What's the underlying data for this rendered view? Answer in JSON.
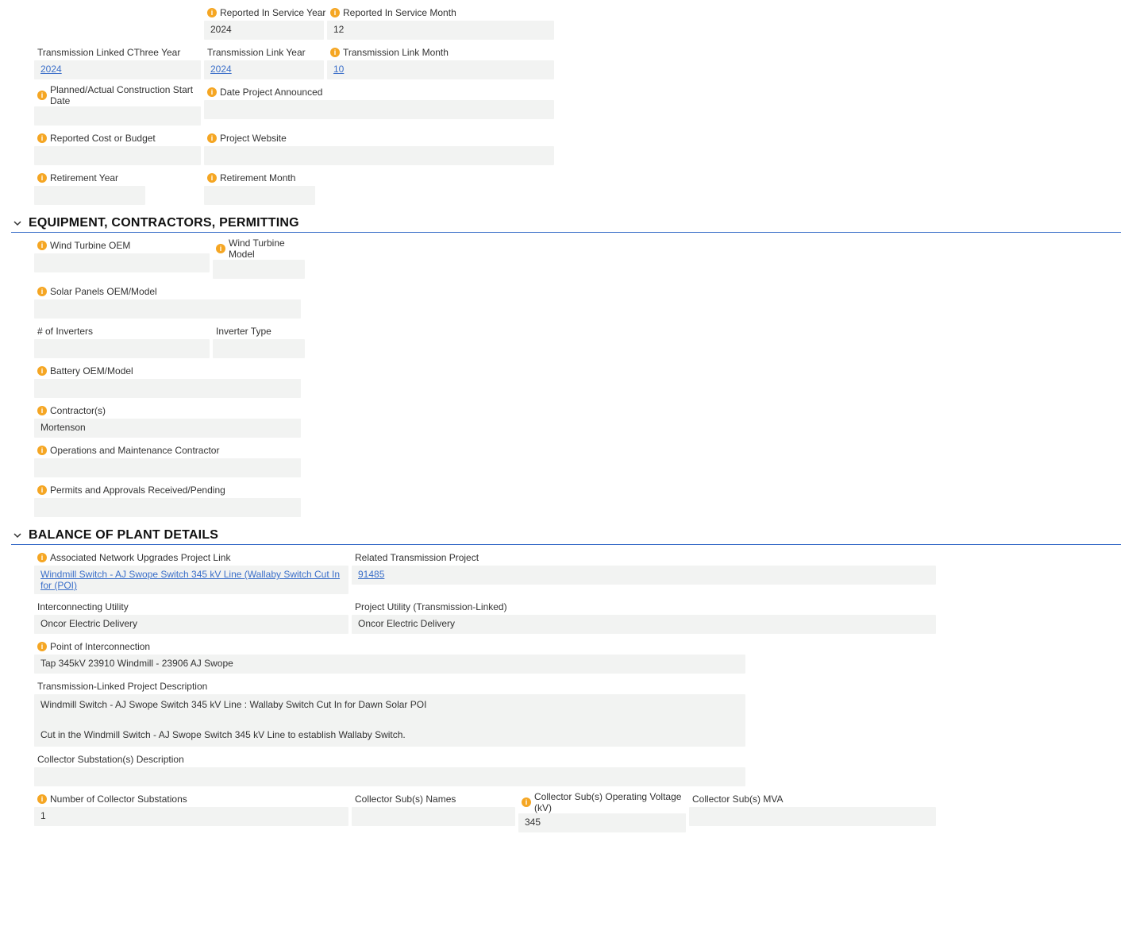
{
  "top": {
    "reported_year_label": "Reported In Service Year",
    "reported_year_value": "2024",
    "reported_month_label": "Reported In Service Month",
    "reported_month_value": "12",
    "trans_cthree_label": "Transmission Linked CThree Year",
    "trans_cthree_value": "2024",
    "trans_link_year_label": "Transmission Link Year",
    "trans_link_year_value": "2024",
    "trans_link_month_label": "Transmission Link Month",
    "trans_link_month_value": "10",
    "construction_start_label": "Planned/Actual Construction Start Date",
    "construction_start_value": "",
    "date_announced_label": "Date Project Announced",
    "date_announced_value": "",
    "reported_cost_label": "Reported Cost or Budget",
    "reported_cost_value": "",
    "project_website_label": "Project Website",
    "project_website_value": "",
    "retirement_year_label": "Retirement Year",
    "retirement_year_value": "",
    "retirement_month_label": "Retirement Month",
    "retirement_month_value": ""
  },
  "sections": {
    "equipment_title": "EQUIPMENT, CONTRACTORS, PERMITTING",
    "balance_title": "BALANCE OF PLANT DETAILS"
  },
  "equipment": {
    "wind_oem_label": "Wind Turbine OEM",
    "wind_oem_value": "",
    "wind_model_label": "Wind Turbine Model",
    "wind_model_value": "",
    "solar_label": "Solar Panels OEM/Model",
    "solar_value": "",
    "inverters_num_label": "# of Inverters",
    "inverters_num_value": "",
    "inverter_type_label": "Inverter Type",
    "inverter_type_value": "",
    "battery_label": "Battery OEM/Model",
    "battery_value": "",
    "contractors_label": "Contractor(s)",
    "contractors_value": "Mortenson",
    "om_label": "Operations and Maintenance Contractor",
    "om_value": "",
    "permits_label": "Permits and Approvals Received/Pending",
    "permits_value": ""
  },
  "balance": {
    "anu_label": "Associated Network Upgrades Project Link",
    "anu_value": "Windmill Switch - AJ Swope Switch 345 kV Line (Wallaby Switch Cut In for (POI)",
    "related_trans_label": "Related Transmission Project",
    "related_trans_value": "91485",
    "inter_utility_label": "Interconnecting Utility",
    "inter_utility_value": "Oncor Electric Delivery",
    "proj_utility_label": "Project Utility (Transmission-Linked)",
    "proj_utility_value": "Oncor Electric Delivery",
    "poi_label": "Point of Interconnection",
    "poi_value": "Tap 345kV 23910 Windmill - 23906 AJ Swope",
    "trans_desc_label": "Transmission-Linked Project Description",
    "trans_desc_value": "Windmill Switch - AJ Swope  Switch 345 kV Line : Wallaby Switch Cut In for Dawn Solar POI\n\nCut in the Windmill Switch - AJ Swope Switch 345 kV Line to establish Wallaby Switch.",
    "coll_desc_label": "Collector Substation(s) Description",
    "coll_desc_value": "",
    "num_coll_label": "Number of Collector Substations",
    "num_coll_value": "1",
    "coll_names_label": "Collector Sub(s) Names",
    "coll_names_value": "",
    "coll_voltage_label": "Collector Sub(s) Operating Voltage (kV)",
    "coll_voltage_value": "345",
    "coll_mva_label": "Collector Sub(s) MVA",
    "coll_mva_value": ""
  }
}
